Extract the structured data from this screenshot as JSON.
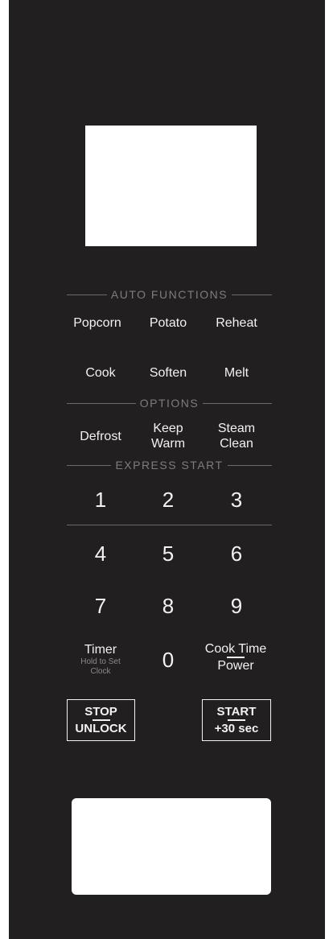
{
  "sections": {
    "auto_functions": "AUTO FUNCTIONS",
    "options": "OPTIONS",
    "express_start": "EXPRESS START"
  },
  "auto": {
    "popcorn": "Popcorn",
    "potato": "Potato",
    "reheat": "Reheat",
    "cook": "Cook",
    "soften": "Soften",
    "melt": "Melt"
  },
  "options": {
    "defrost": "Defrost",
    "keep_warm_1": "Keep",
    "keep_warm_2": "Warm",
    "steam_clean_1": "Steam",
    "steam_clean_2": "Clean"
  },
  "keypad": {
    "k1": "1",
    "k2": "2",
    "k3": "3",
    "k4": "4",
    "k5": "5",
    "k6": "6",
    "k7": "7",
    "k8": "8",
    "k9": "9",
    "k0": "0"
  },
  "timer": {
    "label": "Timer",
    "hint_1": "Hold to Set",
    "hint_2": "Clock"
  },
  "cook_time": {
    "top": "Cook Time",
    "bottom": "Power"
  },
  "stop": {
    "top": "STOP",
    "bottom": "UNLOCK"
  },
  "start": {
    "top": "START",
    "bottom": "+30 sec"
  },
  "colors": {
    "panel": "#221f20",
    "text": "#f2f2f2",
    "muted": "#7d7d7d"
  }
}
